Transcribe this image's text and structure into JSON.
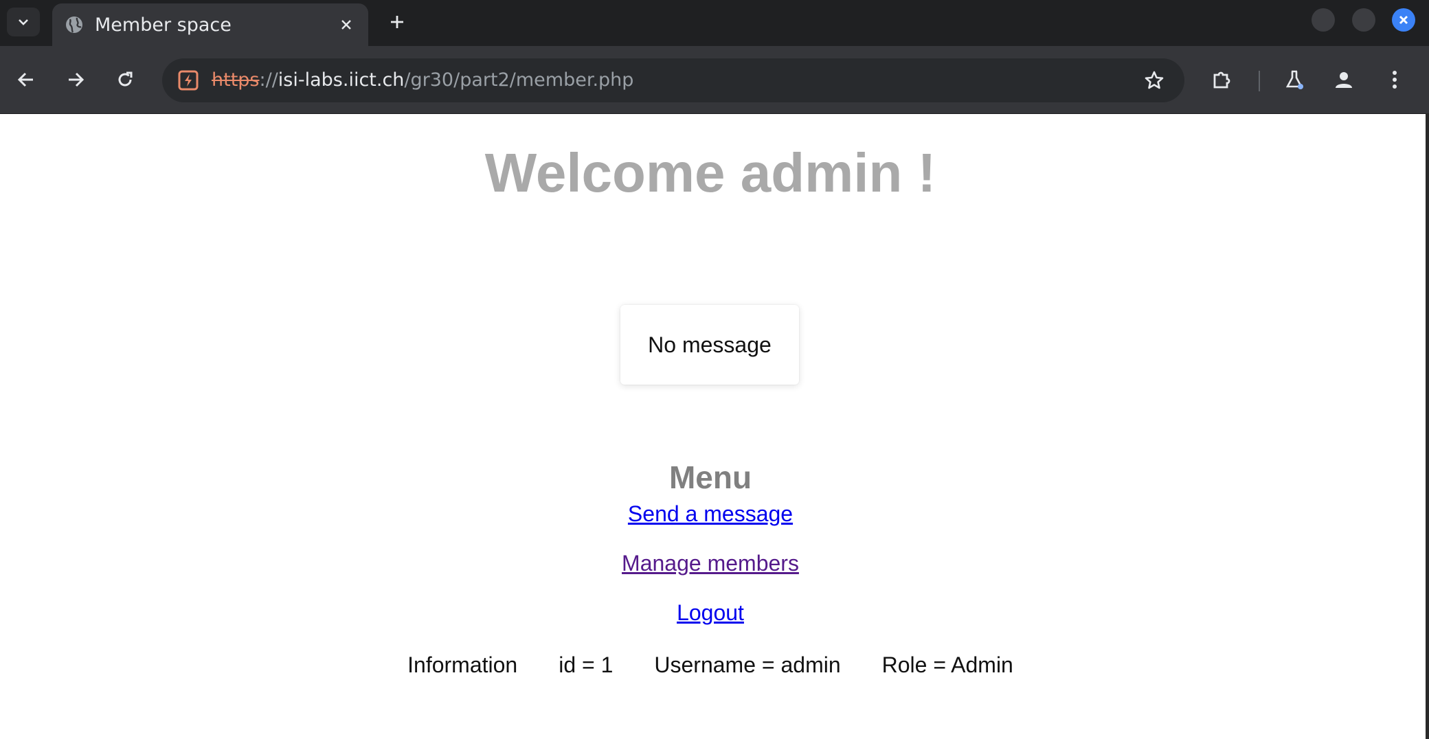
{
  "browser": {
    "tab": {
      "title": "Member space"
    },
    "address": {
      "scheme": "https",
      "separator": "://",
      "host": "isi-labs.iict.ch",
      "path": "/gr30/part2/member.php"
    }
  },
  "page": {
    "heading": "Welcome admin !",
    "message_box": "No message",
    "menu": {
      "title": "Menu",
      "links": [
        {
          "label": "Send a message"
        },
        {
          "label": "Manage members"
        },
        {
          "label": "Logout"
        }
      ]
    },
    "information": {
      "label": "Information",
      "id": "id = 1",
      "username": "Username = admin",
      "role": "Role = Admin"
    }
  },
  "colors": {
    "heading": "#a9a9a9",
    "menu_title": "#808080",
    "link": "#0000ee",
    "visited_link": "#551a8b",
    "insecure_scheme": "#ea8a6a"
  }
}
